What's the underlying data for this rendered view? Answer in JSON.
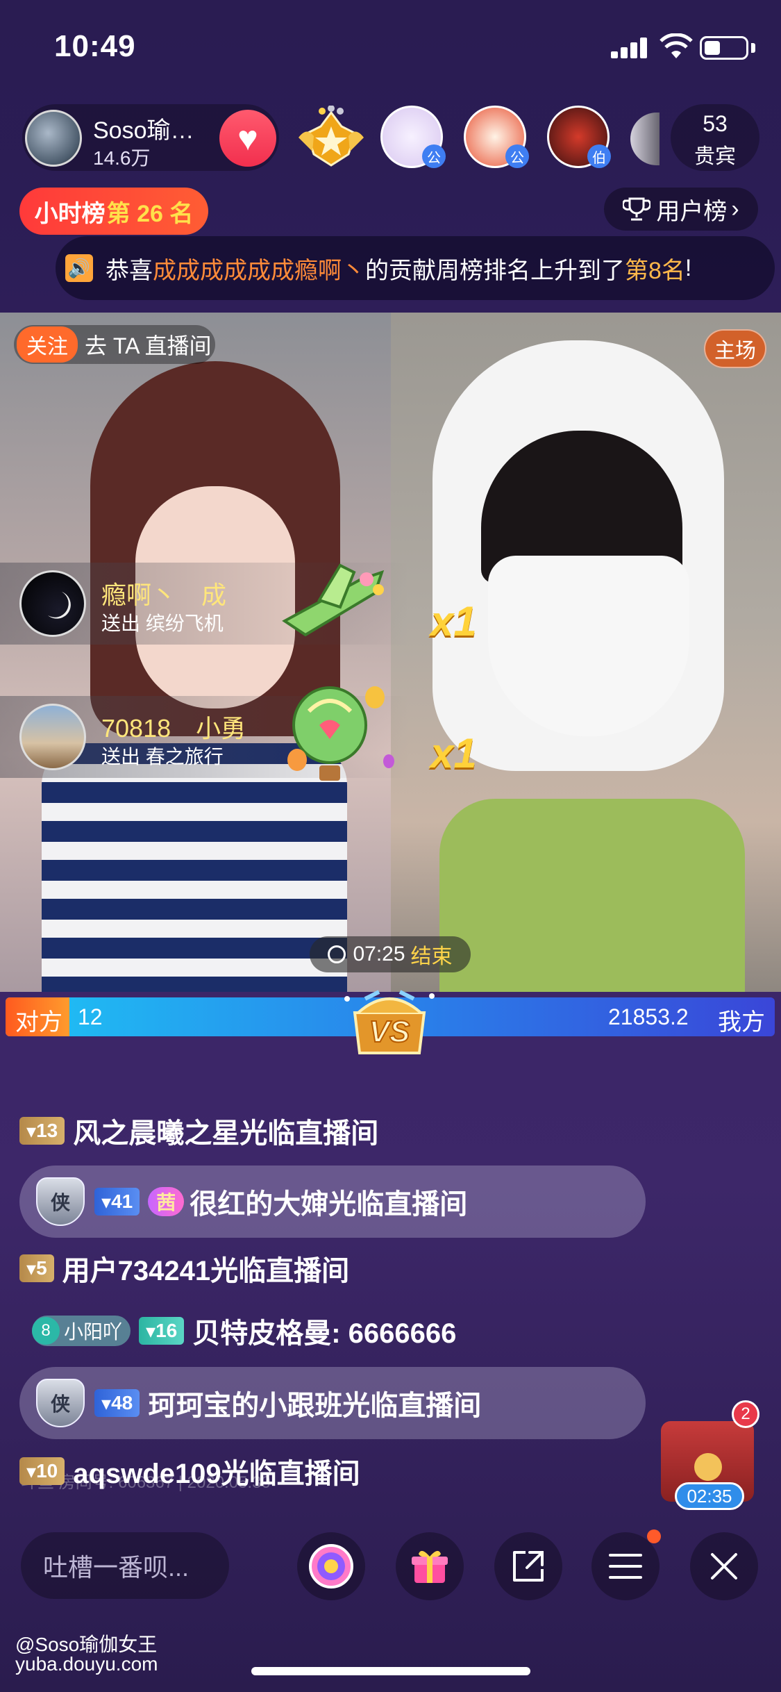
{
  "status_bar": {
    "time": "10:49"
  },
  "host": {
    "name": "Soso瑜…",
    "fans": "14.6万",
    "follow_icon": "heart-icon"
  },
  "top_guests": [
    {
      "tag": "公",
      "colors": [
        "#f7f1ff",
        "#d9c8f0"
      ]
    },
    {
      "tag": "公",
      "colors": [
        "#fff3e6",
        "#e8573a"
      ]
    },
    {
      "tag": "伯",
      "colors": [
        "#3a1010",
        "#d43a2a"
      ]
    }
  ],
  "vip": {
    "count": "53",
    "label": "贵宾"
  },
  "hour_rank": {
    "prefix": "小时榜",
    "rank": "第 26 名"
  },
  "user_rank": {
    "label": "用户榜",
    "icon": "trophy-icon"
  },
  "notice": {
    "prefix": "恭喜",
    "name": "成成成成成成瘾啊丶",
    "middle": "的贡献周榜排名上升到了",
    "rank": "第8名",
    "suffix": "!"
  },
  "video": {
    "follow_label": "关注",
    "goto_live": "去 TA 直播间",
    "home_tag": "主场",
    "multiplier_1": "x1",
    "multiplier_2": "x1"
  },
  "gifts": [
    {
      "user": "瘾啊丶　成\u0000",
      "desc": "送出 缤纷飞机"
    },
    {
      "user": "70818　小勇",
      "desc": "送出 春之旅行"
    }
  ],
  "timer": {
    "time": "07:25",
    "label": "结束"
  },
  "pk": {
    "opponent_label": "对方",
    "opponent_score": "12",
    "my_score": "21853.2",
    "my_label": "我方",
    "opponent_fraction": 0.0005
  },
  "chat": [
    {
      "level": "13",
      "text": "风之晨曦之星光临直播间"
    },
    {
      "shield": "侠",
      "level": "41",
      "fan_badge": "茜",
      "text": "很红的大婶光临直播间"
    },
    {
      "level": "5",
      "text": "用户734241光临直播间"
    },
    {
      "club_num": "8",
      "club_name": "小阳吖",
      "level": "16",
      "text": "贝特皮格曼: 6666666"
    },
    {
      "shield": "侠",
      "level": "48",
      "text": "珂珂宝的小跟班光临直播间"
    },
    {
      "level": "10",
      "text": "aqswde109光临直播间"
    }
  ],
  "chat_watermark": "斗鱼 房间号: 606367 | 2020.05.30",
  "chest": {
    "badge": "2",
    "timer": "02:35"
  },
  "bottom_bar": {
    "input_placeholder": "吐槽一番呗...",
    "buttons": [
      "wheel-icon",
      "gift-icon",
      "share-icon",
      "menu-icon",
      "close-icon"
    ]
  },
  "watermark": {
    "user": "@Soso瑜伽女王",
    "site": "yuba.douyu.com"
  },
  "colors": {
    "accent_orange": "#ff8b39",
    "gold": "#ffd44a",
    "pk_blue": "#2a7ee9",
    "pk_orange": "#ff5a1f"
  }
}
